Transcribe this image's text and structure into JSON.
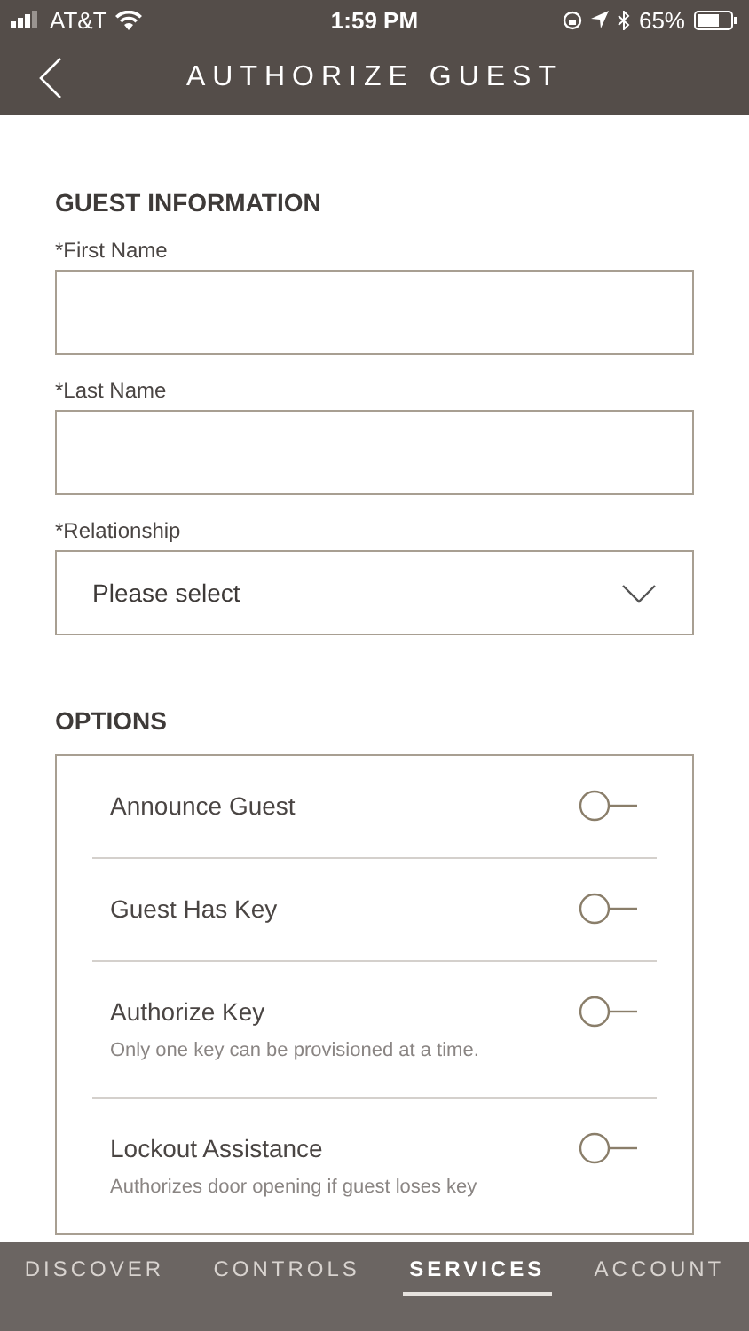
{
  "status_bar": {
    "carrier": "AT&T",
    "time": "1:59 PM",
    "battery": "65%"
  },
  "header": {
    "title": "AUTHORIZE GUEST"
  },
  "guest_information": {
    "heading": "GUEST INFORMATION",
    "fields": [
      {
        "label": "*First Name",
        "kind": "text"
      },
      {
        "label": "*Last Name",
        "kind": "text"
      },
      {
        "label": "*Relationship",
        "kind": "select",
        "placeholder": "Please select"
      }
    ]
  },
  "options": {
    "heading": "OPTIONS",
    "items": [
      {
        "label": "Announce Guest",
        "on": false
      },
      {
        "label": "Guest Has Key",
        "on": false
      },
      {
        "label": "Authorize Key",
        "description": "Only one key can be provisioned at a time.",
        "on": false
      },
      {
        "label": "Lockout Assistance",
        "description": "Authorizes door opening if guest loses key",
        "on": false
      }
    ]
  },
  "tabs": [
    {
      "label": "DISCOVER",
      "selected": false
    },
    {
      "label": "CONTROLS",
      "selected": false
    },
    {
      "label": "SERVICES",
      "selected": true
    },
    {
      "label": "ACCOUNT",
      "selected": false
    }
  ]
}
